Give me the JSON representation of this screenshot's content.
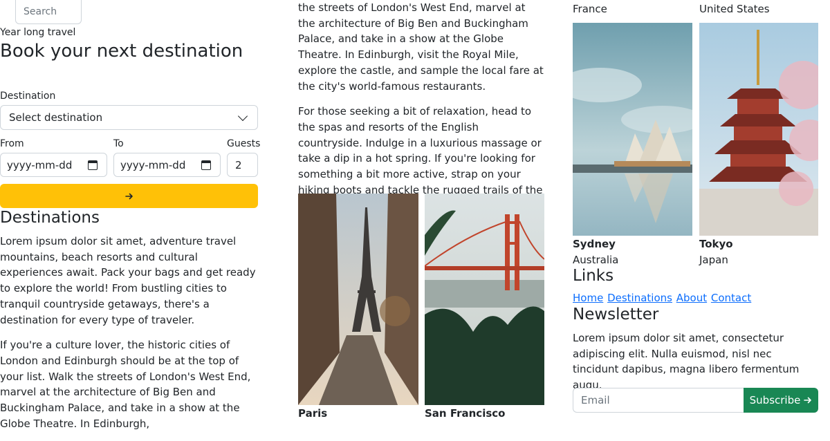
{
  "search": {
    "placeholder": "Search"
  },
  "hero": {
    "eyebrow": "Year long travel",
    "title": "Book your next destination"
  },
  "booking": {
    "destination_label": "Destination",
    "destination_value": "Select destination",
    "from_label": "From",
    "to_label": "To",
    "guests_label": "Guests",
    "from_value": "yyyy-mm-dd",
    "to_value": "yyyy-mm-dd",
    "guests_value": "2",
    "submit_icon": "arrow-right-icon",
    "accent_color": "#ffc107"
  },
  "destinations": {
    "title": "Destinations",
    "paragraphs": [
      "Lorem ipsum dolor sit amet, adventure travel mountains, beach resorts and cultural experiences await. Pack your bags and get ready to explore the world! From bustling cities to tranquil countryside getaways, there's a destination for every type of traveler.",
      "If you're a culture lover, the historic cities of London and Edinburgh should be at the top of your list. Walk the streets of London's West End, marvel at the architecture of Big Ben and Buckingham Palace, and take in a show at the Globe Theatre. In Edinburgh,"
    ]
  },
  "middle": {
    "paragraphs": [
      "the streets of London's West End, marvel at the architecture of Big Ben and Buckingham Palace, and take in a show at the Globe Theatre. In Edinburgh, visit the Royal Mile, explore the castle, and sample the local fare at the city's world-famous restaurants.",
      "For those seeking a bit of relaxation, head to the spas and resorts of the English countryside. Indulge in a luxurious massage or take a dip in a hot spring. If you're looking for something a bit more active, strap on your hiking boots and tackle the rugged trails of the coastal cliffs."
    ]
  },
  "cards": [
    {
      "city": "Paris",
      "country": "France"
    },
    {
      "city": "San Francisco",
      "country": "United States"
    },
    {
      "city": "Sydney",
      "country": "Australia"
    },
    {
      "city": "Tokyo",
      "country": "Japan"
    }
  ],
  "links": {
    "title": "Links",
    "items": [
      "Home",
      "Destinations",
      "About",
      "Contact"
    ]
  },
  "newsletter": {
    "title": "Newsletter",
    "text": "Lorem ipsum dolor sit amet, consectetur adipiscing elit. Nulla euismod, nisl nec tincidunt dapibus, magna libero fermentum augu.",
    "email_placeholder": "Email",
    "subscribe_label": "Subscribe",
    "subscribe_color": "#198754"
  }
}
